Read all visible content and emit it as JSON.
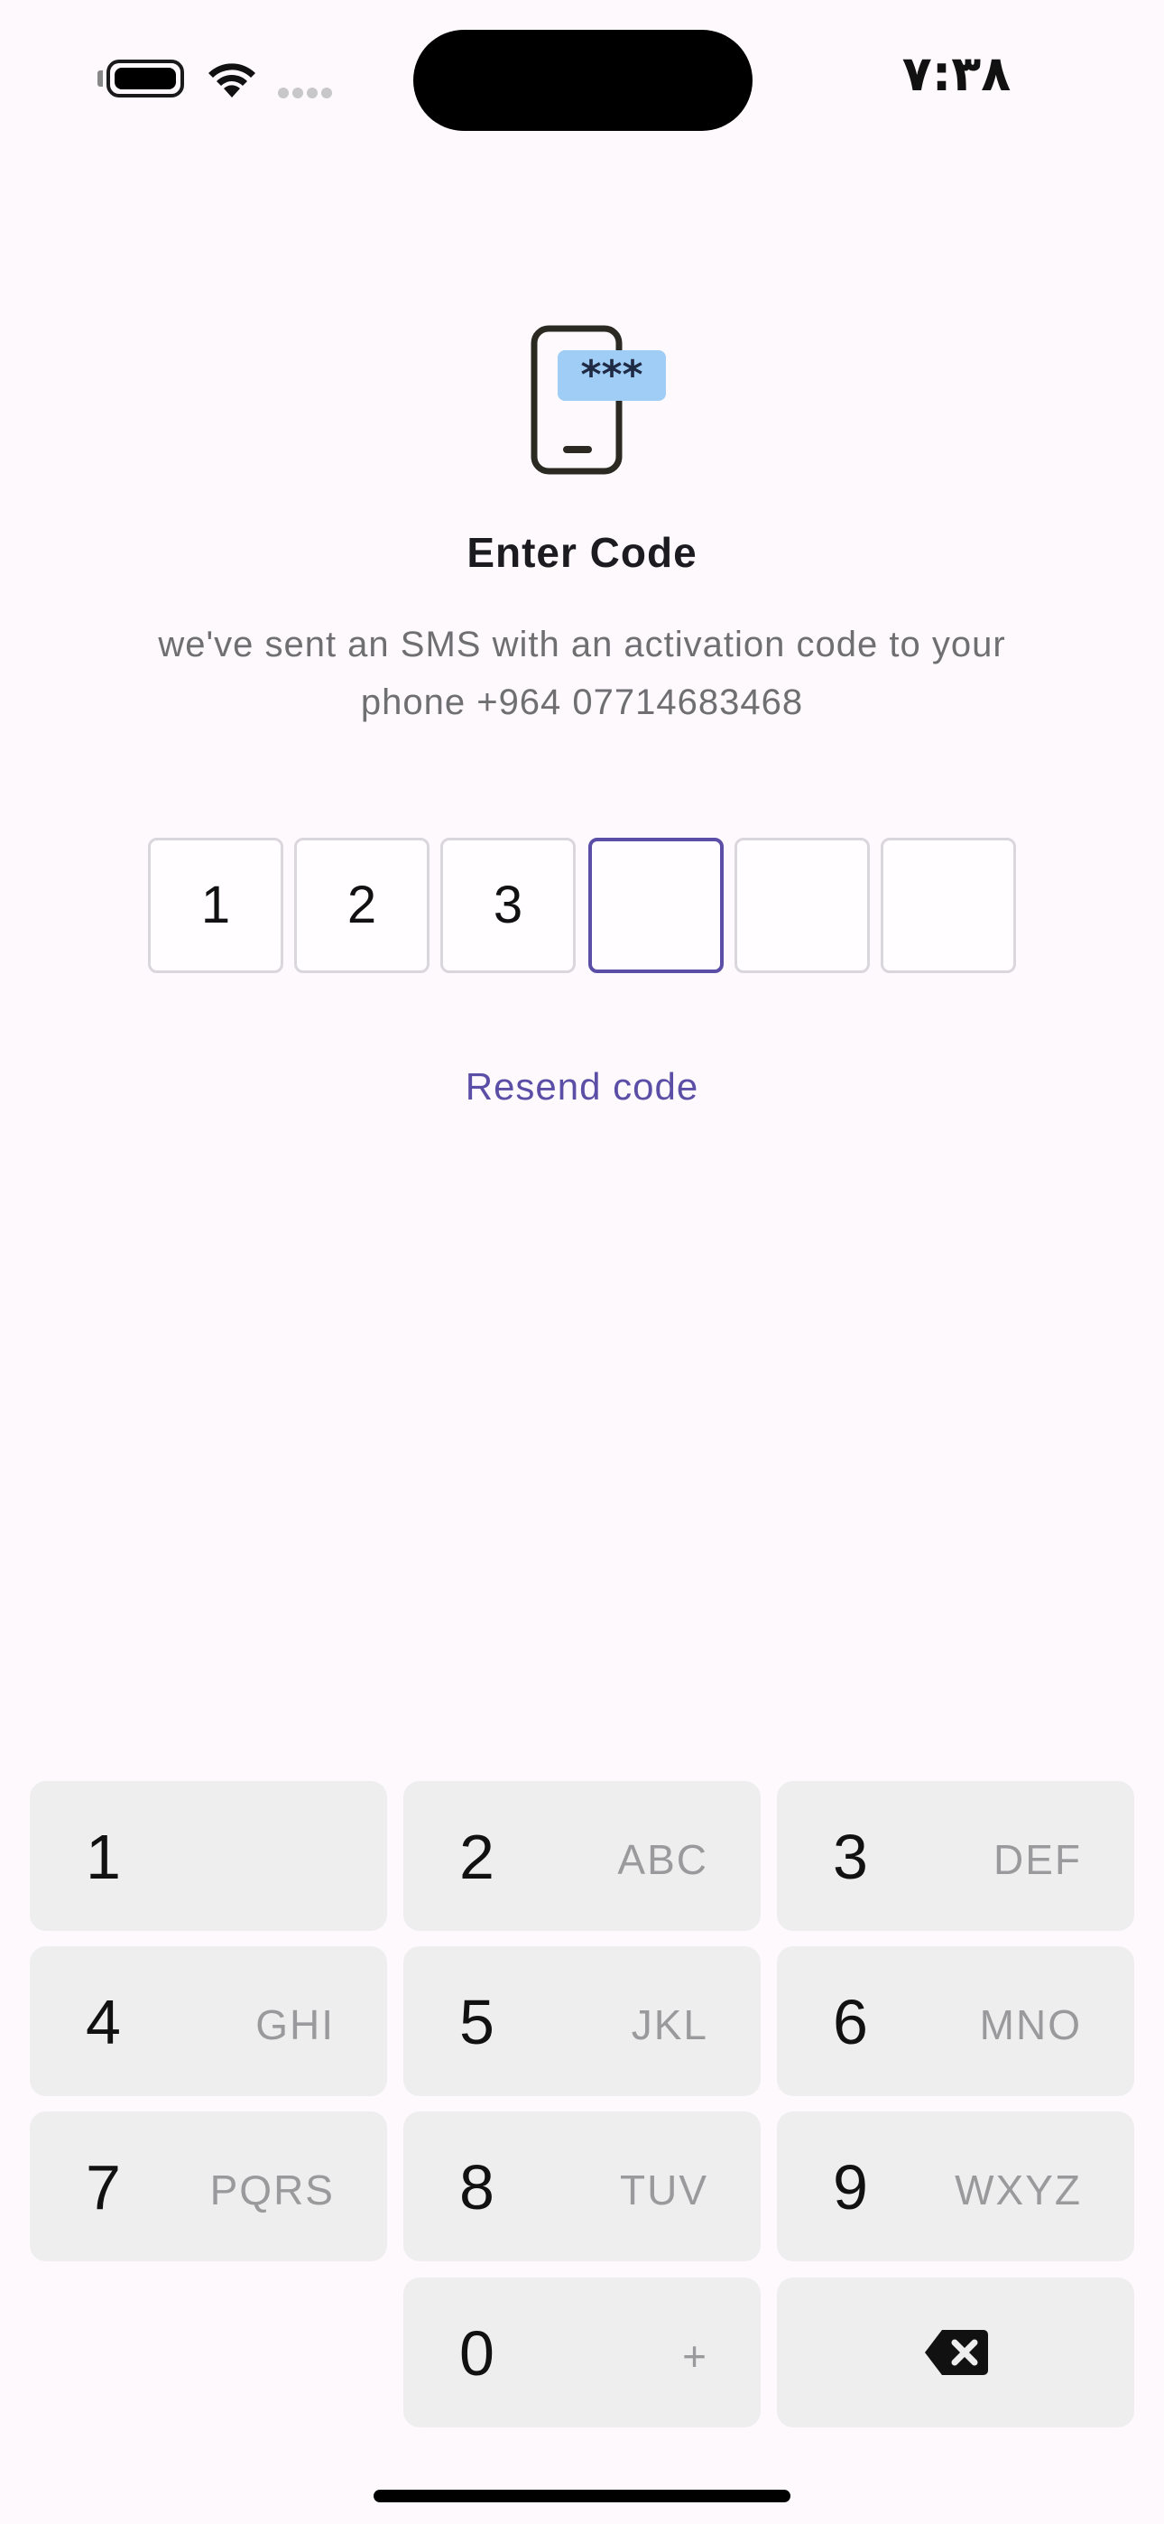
{
  "status_bar": {
    "time": "٧:٣٨"
  },
  "hero": {
    "icon": "phone-sms-code-icon",
    "badge_text": "***"
  },
  "title": "Enter Code",
  "subtitle_line1": "we've sent an SMS with an activation code to your",
  "subtitle_line2": "phone +964 07714683468",
  "code": {
    "digits": [
      "1",
      "2",
      "3",
      "",
      "",
      ""
    ],
    "active_index": 3,
    "accent_color": "#5b4ea6"
  },
  "resend_label": "Resend code",
  "keypad": {
    "keys": [
      {
        "digit": "1",
        "letters": ""
      },
      {
        "digit": "2",
        "letters": "ABC"
      },
      {
        "digit": "3",
        "letters": "DEF"
      },
      {
        "digit": "4",
        "letters": "GHI"
      },
      {
        "digit": "5",
        "letters": "JKL"
      },
      {
        "digit": "6",
        "letters": "MNO"
      },
      {
        "digit": "7",
        "letters": "PQRS"
      },
      {
        "digit": "8",
        "letters": "TUV"
      },
      {
        "digit": "9",
        "letters": "WXYZ"
      },
      {
        "digit": "0",
        "letters": "+"
      }
    ],
    "delete_icon": "backspace-icon"
  }
}
